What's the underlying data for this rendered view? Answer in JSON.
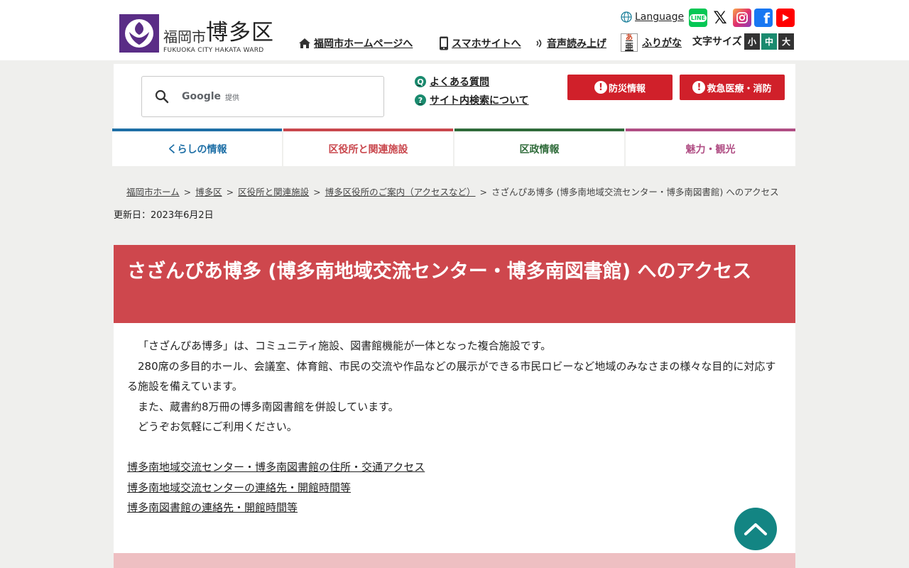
{
  "header": {
    "logo_city": "福岡市",
    "logo_ward": "博多区",
    "logo_en": "FUKUOKA CITY HAKATA WARD",
    "language": "Language",
    "home_link": "福岡市ホームページへ",
    "smartphone_link": "スマホサイトへ",
    "voice_link": "音声読み上げ",
    "furigana_link": "ふりがな",
    "font_size_label": "文字サイズ",
    "font_small": "小",
    "font_medium": "中",
    "font_large": "大",
    "sns": [
      "LINE",
      "X",
      "Instagram",
      "Facebook",
      "YouTube"
    ],
    "line_badge": "LINE",
    "facebook_glyph": "f",
    "x_glyph": "𝕏",
    "furigana_badge_top": "あ",
    "furigana_badge_bottom": "亜"
  },
  "search": {
    "google_label": "Google",
    "google_sub": "提供"
  },
  "help_links": {
    "faq": "よくある質問",
    "faq_icon": "Q",
    "search_about": "サイト内検索について",
    "search_about_icon": "?"
  },
  "emergency": {
    "disaster": "防災情報",
    "medical": "救急医療・消防",
    "icon_glyph": "!"
  },
  "nav": {
    "items": [
      {
        "label": "くらしの情報",
        "color": "#1e6fa6"
      },
      {
        "label": "区役所と関連施設",
        "color": "#c9474d"
      },
      {
        "label": "区政情報",
        "color": "#2f6b3a"
      },
      {
        "label": "魅力・観光",
        "color": "#b04e84"
      }
    ]
  },
  "breadcrumb": {
    "sep": ">",
    "items": [
      "福岡市ホーム",
      "博多区",
      "区役所と関連施設",
      "博多区役所のご案内（アクセスなど）"
    ],
    "current": "さざんぴあ博多 (博多南地域交流センター・博多南図書館) へのアクセス"
  },
  "updated": "更新日：2023年6月2日",
  "page_title": "さざんぴあ博多 (博多南地域交流センター・博多南図書館) へのアクセス",
  "content": {
    "paragraphs": [
      "「さざんぴあ博多」は、コミュニティ施設、図書館機能が一体となった複合施設です。",
      "280席の多目的ホール、会議室、体育館、市民の交流や作品などの展示ができる市民ロビーなど地域のみなさまの様々な目的に対応する施設を備えています。",
      "また、蔵書約8万冊の博多南図書館を併設しています。",
      "どうぞお気軽にご利用ください。"
    ],
    "links": [
      "博多南地域交流センター・博多南図書館の住所・交通アクセス",
      "博多南地域交流センターの連絡先・開館時間等",
      "博多南図書館の連絡先・開館時間等"
    ]
  },
  "colors": {
    "title_band": "#ce474d",
    "emergency_red": "#d0202a",
    "to_top": "#138583",
    "logo_purple": "#5a2d86"
  }
}
